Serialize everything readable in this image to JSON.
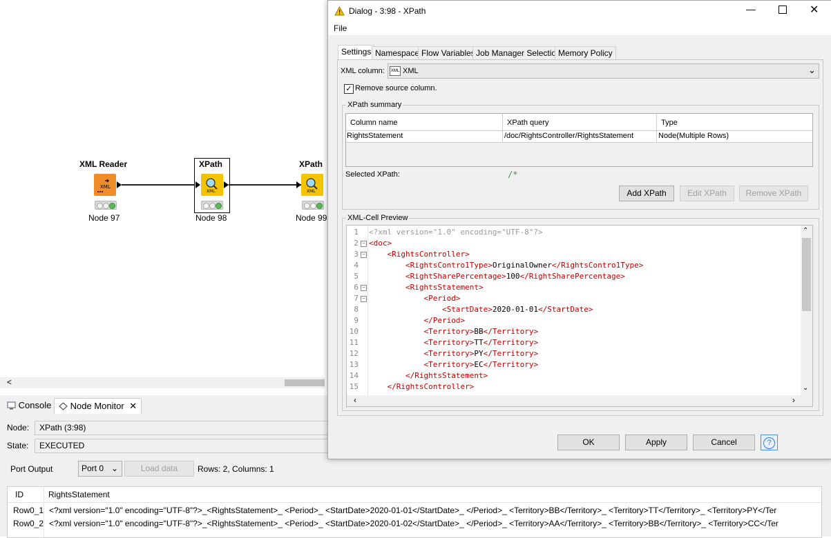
{
  "workflow": {
    "nodes": [
      {
        "title": "XML Reader",
        "label": "Node 97",
        "color": "#f08c2a"
      },
      {
        "title": "XPath",
        "label": "Node 98",
        "color": "#f5c400"
      },
      {
        "title": "XPath",
        "label": "Node 99",
        "color": "#f5c400"
      }
    ],
    "scroll_left": "<"
  },
  "bottom_panel": {
    "tabs": [
      "Console",
      "Node Monitor"
    ],
    "node_label": "Node:",
    "node_value": "XPath  (3:98)",
    "state_label": "State:",
    "state_value": "EXECUTED",
    "port_output_label": "Port Output",
    "port_value": "Port 0",
    "load_data": "Load data",
    "rows_info": "Rows: 2, Columns: 1",
    "table": {
      "columns": [
        "ID",
        "RightsStatement"
      ],
      "rows": [
        {
          "id": "Row0_1",
          "value": "<?xml version=\"1.0\" encoding=\"UTF-8\"?>_<RightsStatement>_   <Period>_      <StartDate>2020-01-01</StartDate>_   </Period>_   <Territory>BB</Territory>_   <Territory>TT</Territory>_   <Territory>PY</Ter"
        },
        {
          "id": "Row0_2",
          "value": "<?xml version=\"1.0\" encoding=\"UTF-8\"?>_<RightsStatement>_   <Period>_      <StartDate>2020-01-02</StartDate>_   </Period>_   <Territory>AA</Territory>_   <Territory>BB</Territory>_   <Territory>CC</Ter"
        }
      ]
    }
  },
  "dialog": {
    "title": "Dialog - 3:98 - XPath",
    "menu_file": "File",
    "tabs": [
      "Settings",
      "Namespace",
      "Flow Variables",
      "Job Manager Selection",
      "Memory Policy"
    ],
    "xml_column_label": "XML column:",
    "xml_column_value": "XML",
    "xml_icon_text": "XML",
    "remove_source": "Remove source column.",
    "xpath_summary_label": "XPath summary",
    "summary_columns": [
      "Column name",
      "XPath query",
      "Type"
    ],
    "summary_rows": [
      {
        "column_name": "RightsStatement",
        "xpath_query": "/doc/RightsController/RightsStatement",
        "type": "Node(Multiple Rows)"
      }
    ],
    "selected_xpath_label": "Selected XPath:",
    "selected_xpath_value": "/*",
    "add_xpath": "Add XPath",
    "edit_xpath": "Edit XPath",
    "remove_xpath": "Remove XPath",
    "preview_label": "XML-Cell Preview",
    "code_lines": [
      {
        "n": "1",
        "indent": 0,
        "open": "",
        "text": "<?xml version=\"1.0\" encoding=\"UTF-8\"?>",
        "close": "",
        "pi": true
      },
      {
        "n": "2",
        "indent": 0,
        "open": "<doc>",
        "text": "",
        "close": "",
        "fold": true
      },
      {
        "n": "3",
        "indent": 1,
        "open": "<RightsController>",
        "text": "",
        "close": "",
        "fold": true
      },
      {
        "n": "4",
        "indent": 2,
        "open": "<RightsContro1Type>",
        "text": "OriginalOwner",
        "close": "</RightsContro1Type>"
      },
      {
        "n": "5",
        "indent": 2,
        "open": "<RightSharePercentage>",
        "text": "100",
        "close": "</RightSharePercentage>"
      },
      {
        "n": "6",
        "indent": 2,
        "open": "<RightsStatement>",
        "text": "",
        "close": "",
        "fold": true
      },
      {
        "n": "7",
        "indent": 3,
        "open": "<Period>",
        "text": "",
        "close": "",
        "fold": true
      },
      {
        "n": "8",
        "indent": 4,
        "open": "<StartDate>",
        "text": "2020-01-01",
        "close": "</StartDate>"
      },
      {
        "n": "9",
        "indent": 3,
        "open": "</Period>",
        "text": "",
        "close": ""
      },
      {
        "n": "10",
        "indent": 3,
        "open": "<Territory>",
        "text": "BB",
        "close": "</Territory>"
      },
      {
        "n": "11",
        "indent": 3,
        "open": "<Territory>",
        "text": "TT",
        "close": "</Territory>"
      },
      {
        "n": "12",
        "indent": 3,
        "open": "<Territory>",
        "text": "PY",
        "close": "</Territory>"
      },
      {
        "n": "13",
        "indent": 3,
        "open": "<Territory>",
        "text": "EC",
        "close": "</Territory>"
      },
      {
        "n": "14",
        "indent": 2,
        "open": "</RightsStatement>",
        "text": "",
        "close": ""
      },
      {
        "n": "15",
        "indent": 1,
        "open": "</RightsController>",
        "text": "",
        "close": ""
      }
    ],
    "ok": "OK",
    "apply": "Apply",
    "cancel": "Cancel",
    "help": "?"
  }
}
